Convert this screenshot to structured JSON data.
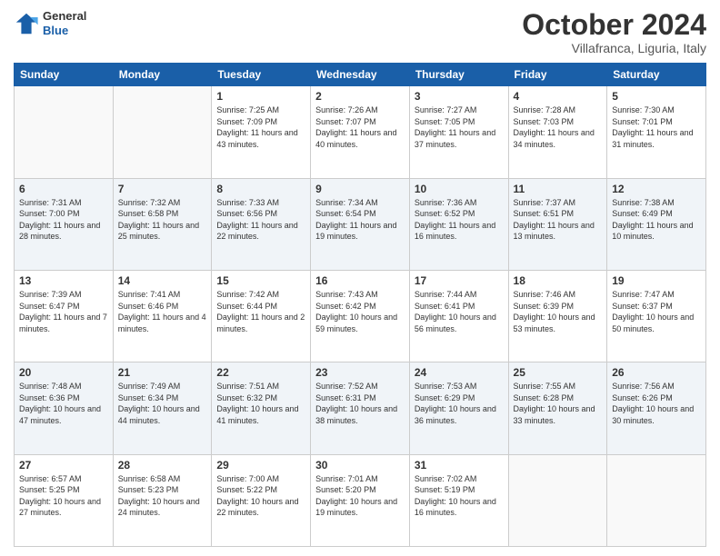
{
  "header": {
    "logo": {
      "line1": "General",
      "line2": "Blue"
    },
    "title": "October 2024",
    "subtitle": "Villafranca, Liguria, Italy"
  },
  "weekdays": [
    "Sunday",
    "Monday",
    "Tuesday",
    "Wednesday",
    "Thursday",
    "Friday",
    "Saturday"
  ],
  "weeks": [
    [
      {
        "day": "",
        "info": ""
      },
      {
        "day": "",
        "info": ""
      },
      {
        "day": "1",
        "info": "Sunrise: 7:25 AM\nSunset: 7:09 PM\nDaylight: 11 hours and 43 minutes."
      },
      {
        "day": "2",
        "info": "Sunrise: 7:26 AM\nSunset: 7:07 PM\nDaylight: 11 hours and 40 minutes."
      },
      {
        "day": "3",
        "info": "Sunrise: 7:27 AM\nSunset: 7:05 PM\nDaylight: 11 hours and 37 minutes."
      },
      {
        "day": "4",
        "info": "Sunrise: 7:28 AM\nSunset: 7:03 PM\nDaylight: 11 hours and 34 minutes."
      },
      {
        "day": "5",
        "info": "Sunrise: 7:30 AM\nSunset: 7:01 PM\nDaylight: 11 hours and 31 minutes."
      }
    ],
    [
      {
        "day": "6",
        "info": "Sunrise: 7:31 AM\nSunset: 7:00 PM\nDaylight: 11 hours and 28 minutes."
      },
      {
        "day": "7",
        "info": "Sunrise: 7:32 AM\nSunset: 6:58 PM\nDaylight: 11 hours and 25 minutes."
      },
      {
        "day": "8",
        "info": "Sunrise: 7:33 AM\nSunset: 6:56 PM\nDaylight: 11 hours and 22 minutes."
      },
      {
        "day": "9",
        "info": "Sunrise: 7:34 AM\nSunset: 6:54 PM\nDaylight: 11 hours and 19 minutes."
      },
      {
        "day": "10",
        "info": "Sunrise: 7:36 AM\nSunset: 6:52 PM\nDaylight: 11 hours and 16 minutes."
      },
      {
        "day": "11",
        "info": "Sunrise: 7:37 AM\nSunset: 6:51 PM\nDaylight: 11 hours and 13 minutes."
      },
      {
        "day": "12",
        "info": "Sunrise: 7:38 AM\nSunset: 6:49 PM\nDaylight: 11 hours and 10 minutes."
      }
    ],
    [
      {
        "day": "13",
        "info": "Sunrise: 7:39 AM\nSunset: 6:47 PM\nDaylight: 11 hours and 7 minutes."
      },
      {
        "day": "14",
        "info": "Sunrise: 7:41 AM\nSunset: 6:46 PM\nDaylight: 11 hours and 4 minutes."
      },
      {
        "day": "15",
        "info": "Sunrise: 7:42 AM\nSunset: 6:44 PM\nDaylight: 11 hours and 2 minutes."
      },
      {
        "day": "16",
        "info": "Sunrise: 7:43 AM\nSunset: 6:42 PM\nDaylight: 10 hours and 59 minutes."
      },
      {
        "day": "17",
        "info": "Sunrise: 7:44 AM\nSunset: 6:41 PM\nDaylight: 10 hours and 56 minutes."
      },
      {
        "day": "18",
        "info": "Sunrise: 7:46 AM\nSunset: 6:39 PM\nDaylight: 10 hours and 53 minutes."
      },
      {
        "day": "19",
        "info": "Sunrise: 7:47 AM\nSunset: 6:37 PM\nDaylight: 10 hours and 50 minutes."
      }
    ],
    [
      {
        "day": "20",
        "info": "Sunrise: 7:48 AM\nSunset: 6:36 PM\nDaylight: 10 hours and 47 minutes."
      },
      {
        "day": "21",
        "info": "Sunrise: 7:49 AM\nSunset: 6:34 PM\nDaylight: 10 hours and 44 minutes."
      },
      {
        "day": "22",
        "info": "Sunrise: 7:51 AM\nSunset: 6:32 PM\nDaylight: 10 hours and 41 minutes."
      },
      {
        "day": "23",
        "info": "Sunrise: 7:52 AM\nSunset: 6:31 PM\nDaylight: 10 hours and 38 minutes."
      },
      {
        "day": "24",
        "info": "Sunrise: 7:53 AM\nSunset: 6:29 PM\nDaylight: 10 hours and 36 minutes."
      },
      {
        "day": "25",
        "info": "Sunrise: 7:55 AM\nSunset: 6:28 PM\nDaylight: 10 hours and 33 minutes."
      },
      {
        "day": "26",
        "info": "Sunrise: 7:56 AM\nSunset: 6:26 PM\nDaylight: 10 hours and 30 minutes."
      }
    ],
    [
      {
        "day": "27",
        "info": "Sunrise: 6:57 AM\nSunset: 5:25 PM\nDaylight: 10 hours and 27 minutes."
      },
      {
        "day": "28",
        "info": "Sunrise: 6:58 AM\nSunset: 5:23 PM\nDaylight: 10 hours and 24 minutes."
      },
      {
        "day": "29",
        "info": "Sunrise: 7:00 AM\nSunset: 5:22 PM\nDaylight: 10 hours and 22 minutes."
      },
      {
        "day": "30",
        "info": "Sunrise: 7:01 AM\nSunset: 5:20 PM\nDaylight: 10 hours and 19 minutes."
      },
      {
        "day": "31",
        "info": "Sunrise: 7:02 AM\nSunset: 5:19 PM\nDaylight: 10 hours and 16 minutes."
      },
      {
        "day": "",
        "info": ""
      },
      {
        "day": "",
        "info": ""
      }
    ]
  ]
}
